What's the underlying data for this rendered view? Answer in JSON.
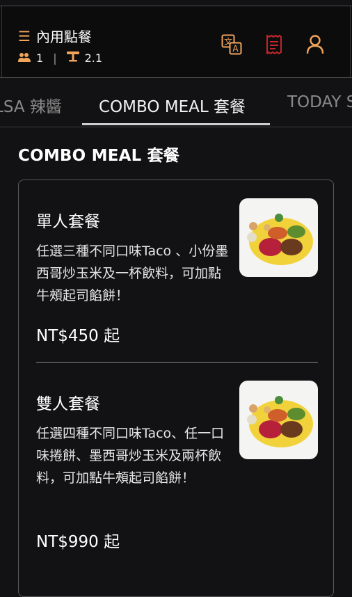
{
  "header": {
    "mode_label": "內用點餐",
    "guests": "1",
    "table": "2.1",
    "icons": [
      "menu-icon",
      "guests-icon",
      "table-icon",
      "translate-icon",
      "receipt-icon",
      "account-icon"
    ],
    "colors": {
      "accent": "#f0a55b",
      "receipt": "#c0262c",
      "background": "#121214"
    }
  },
  "tabs": [
    {
      "label": "LSA 辣醬"
    },
    {
      "label": "COMBO MEAL 套餐"
    },
    {
      "label": "TODAY S"
    }
  ],
  "section": {
    "title": "COMBO MEAL 套餐"
  },
  "items": [
    {
      "name": "單人套餐",
      "desc": "任選三種不同口味Taco 、小份墨西哥炒玉米及一杯飲料，可加點牛頰起司餡餅！",
      "price": "NT$450 起"
    },
    {
      "name": "雙人套餐",
      "desc": "任選四種不同口味Taco、任一口味捲餅、墨西哥炒玉米及兩杯飲料，可加點牛頰起司餡餅！",
      "price": "NT$990 起"
    }
  ]
}
